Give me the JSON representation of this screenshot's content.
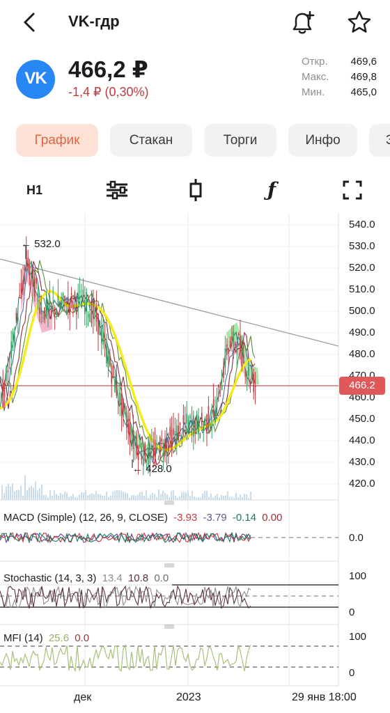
{
  "header": {
    "title": "VK-гдр"
  },
  "quote": {
    "logo_text": "VK",
    "price": "466,2 ₽",
    "change": "-1,4 ₽ (0,30%)",
    "stats": [
      {
        "label": "Откр.",
        "value": "469,6"
      },
      {
        "label": "Макс.",
        "value": "469,8"
      },
      {
        "label": "Мин.",
        "value": "465,0"
      }
    ]
  },
  "tabs": [
    {
      "label": "График",
      "active": true
    },
    {
      "label": "Стакан",
      "active": false
    },
    {
      "label": "Торги",
      "active": false
    },
    {
      "label": "Инфо",
      "active": false
    },
    {
      "label": "З",
      "active": false
    }
  ],
  "toolbar": {
    "interval": "H1",
    "indicators_icon": "sliders-icon",
    "chart_type_icon": "candlestick-icon",
    "functions_icon": "function-icon",
    "fullscreen_icon": "fullscreen-icon"
  },
  "chart": {
    "price_axis": [
      "540.0",
      "530.0",
      "520.0",
      "510.0",
      "500.0",
      "490.0",
      "480.0",
      "470.0",
      "460.0",
      "450.0",
      "440.0",
      "430.0",
      "420.0"
    ],
    "last_price": "466.2",
    "high_annotation": "← 532.0",
    "low_annotation": "← 428.0",
    "x_labels": [
      "дек",
      "2023",
      "29 янв 18:00"
    ],
    "colors": {
      "up": "#2e9e5e",
      "down": "#c2393f",
      "moving_average": "#f5ea1c",
      "price_line": "#c05858",
      "trend_line": "#9a9aa8",
      "cloud_up": "#8fdf8f",
      "cloud_down": "#f2a0b8"
    }
  },
  "macd": {
    "name": "MACD (Simple) (12, 26, 9, CLOSE)",
    "v1": "-3.93",
    "v2": "-3.79",
    "v3": "-0.14",
    "v4": "0.00",
    "axis": "0.0"
  },
  "stochastic": {
    "name": "Stochastic (14, 3, 3)",
    "v1": "13.4",
    "v2": "10.8",
    "v3": "0.0",
    "axis_top": "100",
    "axis_bottom": "0"
  },
  "mfi": {
    "name": "MFI (14)",
    "v1": "25.6",
    "v2": "0.0",
    "axis_top": "100",
    "axis_bottom": "0"
  }
}
